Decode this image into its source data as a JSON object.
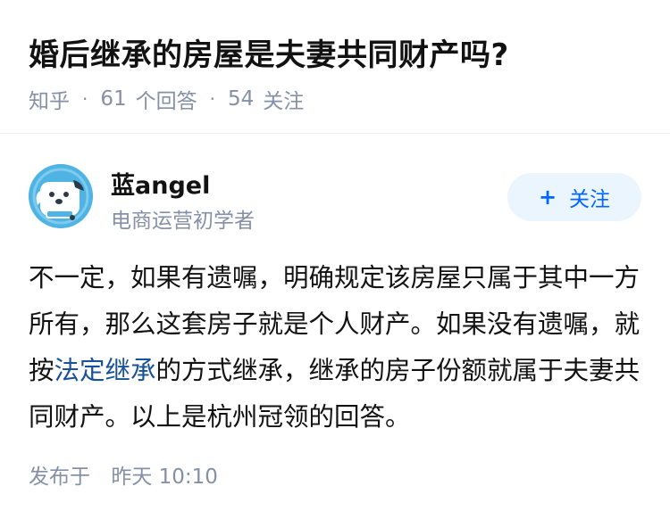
{
  "question": {
    "title": "婚后继承的房屋是夫妻共同财产吗?",
    "source": "知乎",
    "answer_count": "61",
    "answer_label": "个回答",
    "follow_count": "54",
    "follow_label": "关注",
    "separator": "·"
  },
  "author": {
    "name": "蓝angel",
    "bio": "电商运营初学者",
    "avatar_icon": "dog-avatar-icon",
    "follow_button": {
      "plus": "+",
      "label": "关注"
    }
  },
  "answer": {
    "text_before_link": "不一定，如果有遗嘱，明确规定该房屋只属于其中一方所有，那么这套房子就是个人财产。如果没有遗嘱，就按",
    "link_text": "法定继承",
    "text_after_link": "的方式继承，继承的房子份额就属于夫妻共同财产。以上是杭州冠领的回答。"
  },
  "footer": {
    "published_label": "发布于",
    "published_time": "昨天 10:10"
  },
  "colors": {
    "link": "#175199",
    "meta": "#8590a6",
    "follow_bg": "#ebf5fd",
    "follow_text": "#0066ff",
    "avatar_bg": "#4fb4e4"
  }
}
